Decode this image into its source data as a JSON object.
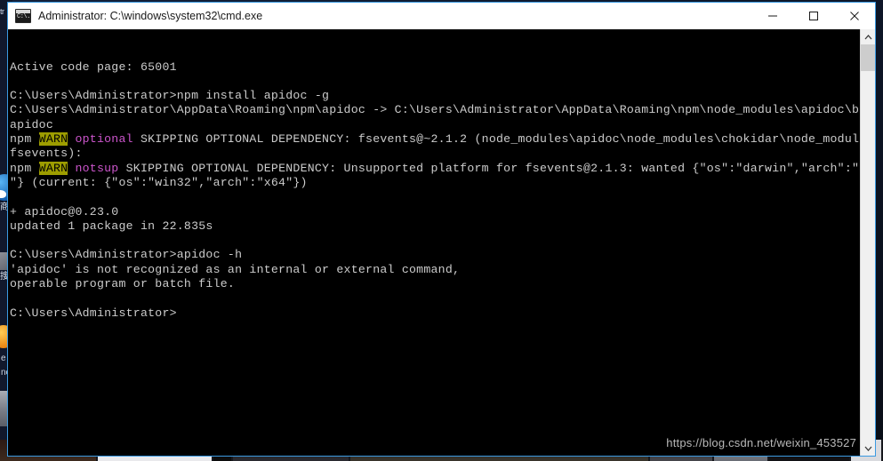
{
  "window": {
    "title": "Administrator: C:\\windows\\system32\\cmd.exe",
    "icon_name": "cmd-exe-icon",
    "icon_glyph": "C:\\.",
    "border_color": "#3b9ae1",
    "controls": {
      "minimize_name": "minimize-button",
      "maximize_name": "maximize-button",
      "close_name": "close-button"
    }
  },
  "console": {
    "background": "#000000",
    "foreground": "#cccccc",
    "warn_bg": "#9d9d00",
    "warn_fg": "#000000",
    "magenta": "#cc55cc",
    "lines": [
      {
        "text": "Active code page: 65001"
      },
      {
        "text": ""
      },
      {
        "text": "C:\\Users\\Administrator>npm install apidoc -g"
      },
      {
        "text": "C:\\Users\\Administrator\\AppData\\Roaming\\npm\\apidoc -> C:\\Users\\Administrator\\AppData\\Roaming\\npm\\node_modules\\apidoc\\bin\\"
      },
      {
        "text": "apidoc"
      },
      {
        "segments": [
          {
            "text": "npm "
          },
          {
            "text": "WARN",
            "style": "warn"
          },
          {
            "text": " "
          },
          {
            "text": "optional",
            "style": "magenta"
          },
          {
            "text": " SKIPPING OPTIONAL DEPENDENCY: fsevents@~2.1.2 (node_modules\\apidoc\\node_modules\\chokidar\\node_modules\\"
          }
        ]
      },
      {
        "text": "fsevents):"
      },
      {
        "segments": [
          {
            "text": "npm "
          },
          {
            "text": "WARN",
            "style": "warn"
          },
          {
            "text": " "
          },
          {
            "text": "notsup",
            "style": "magenta"
          },
          {
            "text": " SKIPPING OPTIONAL DEPENDENCY: Unsupported platform for fsevents@2.1.3: wanted {\"os\":\"darwin\",\"arch\":\"any"
          }
        ]
      },
      {
        "text": "\"} (current: {\"os\":\"win32\",\"arch\":\"x64\"})"
      },
      {
        "text": ""
      },
      {
        "text": "+ apidoc@0.23.0"
      },
      {
        "text": "updated 1 package in 22.835s"
      },
      {
        "text": ""
      },
      {
        "text": "C:\\Users\\Administrator>apidoc -h"
      },
      {
        "text": "'apidoc' is not recognized as an internal or external command,"
      },
      {
        "text": "operable program or batch file."
      },
      {
        "text": ""
      },
      {
        "text": "C:\\Users\\Administrator>"
      }
    ]
  },
  "scrollbar": {
    "up_arrow_name": "scroll-up-arrow",
    "down_arrow_name": "scroll-down-arrow",
    "thumb_name": "scroll-thumb"
  },
  "watermark": {
    "text": "https://blog.csdn.net/weixin_453527"
  },
  "desktop": {
    "sidebar_label_top": "tr",
    "sidebar_label_cn_1": "商",
    "sidebar_label_cn_2": "搜",
    "sidebar_text_e1": "e",
    "sidebar_text_e2": "ne"
  }
}
